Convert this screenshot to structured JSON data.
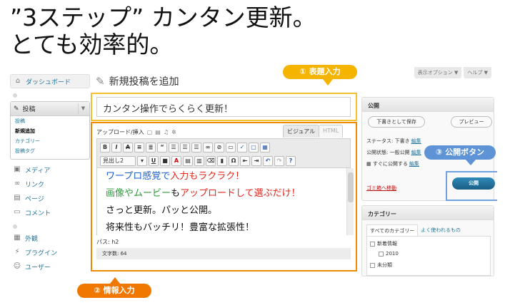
{
  "headline": {
    "line1": "”3ステップ” カンタン更新。",
    "line2": "とても効率的。"
  },
  "sidebar": {
    "dashboard": "ダッシュボード",
    "posts": "投稿",
    "posts_sub": [
      "投稿",
      "新規追加",
      "カテゴリー",
      "投稿タグ"
    ],
    "media": "メディア",
    "links": "リンク",
    "pages": "ページ",
    "comments": "コメント",
    "appearance": "外観",
    "plugins": "プラグイン",
    "users": "ユーザー"
  },
  "header": {
    "page_title": "新規投稿を追加",
    "screen_options": "表示オプション ▼",
    "help": "ヘルプ ▼"
  },
  "title_field": {
    "value": "カンタン操作でらくらく更新！"
  },
  "editor": {
    "upload_label": "アップロード/挿入",
    "tab_visual": "ビジュアル",
    "tab_html": "HTML",
    "format_select": "見出し2",
    "line1_blue": "ワープロ感覚で",
    "line1_red": "入力もラクラク！",
    "line2_green": "画像やムービー",
    "line2_black": "も",
    "line2_red": "アップロードして選ぶだけ！",
    "line3": "さっと更新。パッと公開。",
    "line4": "将来性もバッチリ！豊富な拡張性！",
    "path": "パス: h2",
    "word_count": "文字数: 64"
  },
  "publish": {
    "title": "公開",
    "save_draft": "下書きとして保存",
    "preview": "プレビュー",
    "status_label": "ステータス: 下書き",
    "visibility_label": "公開状態: 一般公開",
    "schedule_label": "すぐに公開する",
    "edit": "編集",
    "trash": "ゴミ箱へ移動",
    "publish_btn": "公開"
  },
  "categories": {
    "title": "カテゴリー",
    "tab_all": "すべてのカテゴリー",
    "tab_popular": "よく使われるもの",
    "items": [
      "新着情報",
      "2010",
      "未分類"
    ]
  },
  "callouts": {
    "step1": "① 表題入力",
    "step2": "② 情報入力",
    "step3": "③ 公開ボタン"
  },
  "colors": {
    "step1": "#f5b400",
    "step2": "#f07800",
    "step3": "#5e93d6",
    "wp_link": "#21759b"
  }
}
